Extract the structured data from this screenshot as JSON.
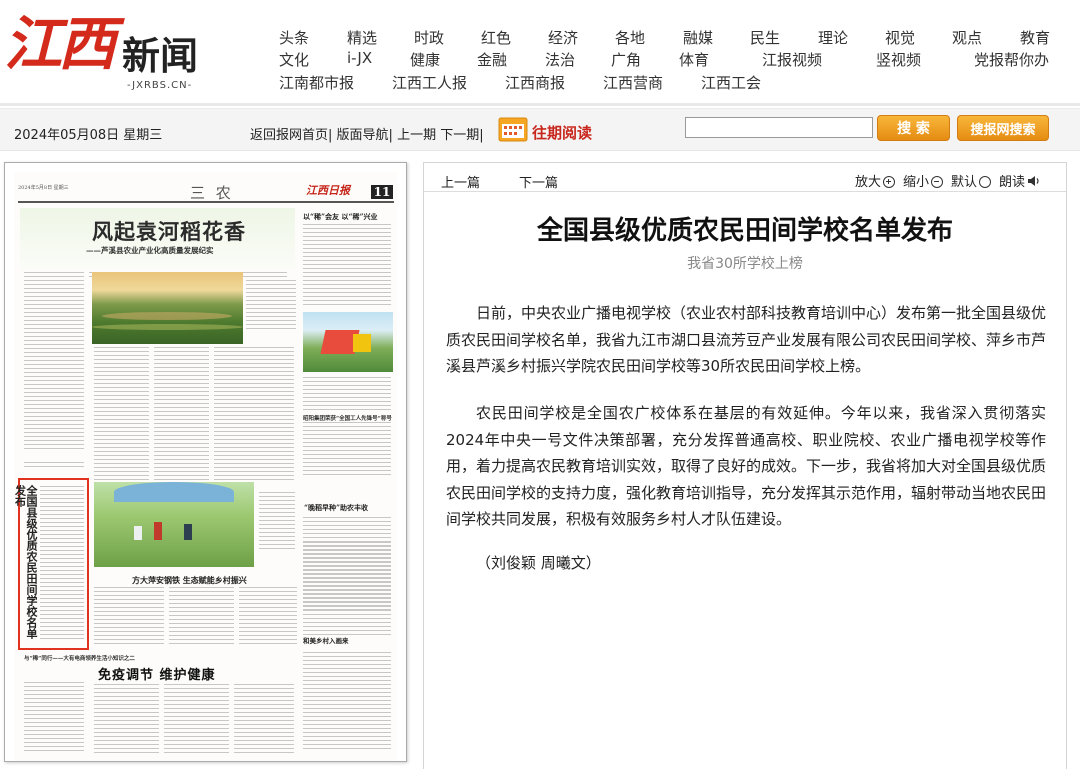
{
  "site": {
    "logo_main": "江西",
    "logo_sub": "新闻",
    "logo_url": "-JXRBS.CN-"
  },
  "nav": {
    "row1": [
      "头条",
      "精选",
      "时政",
      "红色",
      "经济",
      "各地",
      "融媒",
      "民生",
      "理论",
      "视觉",
      "观点",
      "教育"
    ],
    "row2": [
      "文化",
      "i-JX",
      "健康",
      "金融",
      "法治",
      "广角",
      "体育",
      "江报视频",
      "竖视频",
      "党报帮你办"
    ],
    "row3": [
      "江南都市报",
      "江西工人报",
      "江西商报",
      "江西营商",
      "江西工会"
    ]
  },
  "toolbar": {
    "date": "2024年05月08日 星期三",
    "links": [
      "返回报网首页",
      "版面导航",
      "上一期",
      "下一期"
    ],
    "archive": "往期阅读",
    "search_placeholder": "",
    "search_button": "搜 索",
    "site_search_button": "搜报网搜索"
  },
  "paper": {
    "date_line": "2024年5月8日 星期三",
    "section": "三 农",
    "masthead": "江西日报",
    "page_no": "11",
    "headline": "风起袁河稻花香",
    "subhead": "——芦溪县农业产业化高质量发展纪实",
    "right_top": "以“稀”会友 以“稀”兴业",
    "highlighted_vertical": "全国县级优质农民田间学校名单发布",
    "mid_headline": "“晚稻早种”助农丰收",
    "caption": "方大萍安钢铁 生态赋能乡村振兴",
    "bottom_kicker": "与“稀”同行——大有电商领养生活小知识之二",
    "bottom_headline": "免疫调节 维护健康",
    "bottom_right": "和美乡村入画来",
    "side_right": "昭阳集团荣获“全国工人先锋号”称号"
  },
  "article": {
    "prev": "上一篇",
    "next": "下一篇",
    "tools": {
      "zoom_in": "放大",
      "zoom_out": "缩小",
      "default": "默认",
      "read": "朗读"
    },
    "title": "全国县级优质农民田间学校名单发布",
    "subtitle": "我省30所学校上榜",
    "paragraphs": [
      "日前，中央农业广播电视学校（农业农村部科技教育培训中心）发布第一批全国县级优质农民田间学校名单，我省九江市湖口县流芳豆产业发展有限公司农民田间学校、萍乡市芦溪县芦溪乡村振兴学院农民田间学校等30所农民田间学校上榜。",
      "农民田间学校是全国农广校体系在基层的有效延伸。今年以来，我省深入贯彻落实2024年中央一号文件决策部署，充分发挥普通高校、职业院校、农业广播电视学校等作用，着力提高农民教育培训实效，取得了良好的成效。下一步，我省将加大对全国县级优质农民田间学校的支持力度，强化教育培训指导，充分发挥其示范作用，辐射带动当地农民田间学校共同发展，积极有效服务乡村人才队伍建设。"
    ],
    "byline": "（刘俊颖 周曦文）"
  },
  "colors": {
    "brand_red": "#d42a1c",
    "button_orange": "#f0a02a",
    "highlight_red": "#e0321e"
  }
}
